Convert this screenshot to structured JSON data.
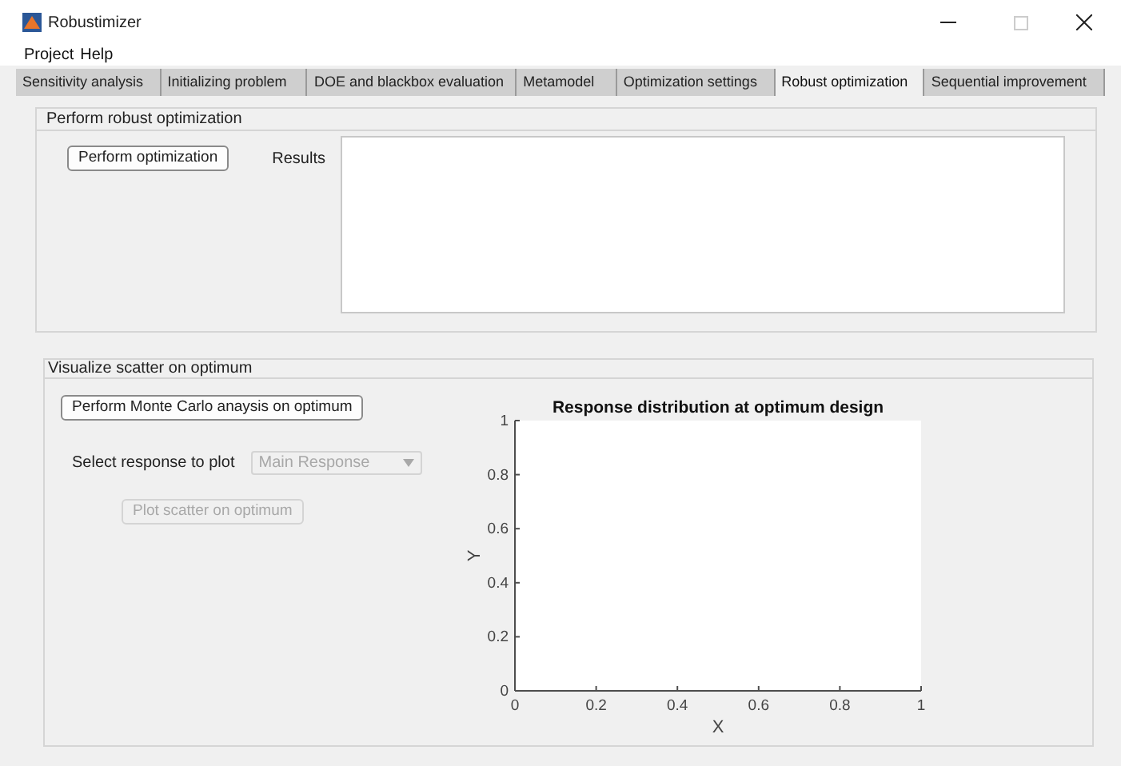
{
  "window": {
    "title": "Robustimizer"
  },
  "menu": [
    "Project",
    "Help"
  ],
  "tabs": [
    {
      "label": "Sensitivity analysis",
      "selected": false
    },
    {
      "label": "Initializing problem",
      "selected": false
    },
    {
      "label": "DOE and blackbox evaluation",
      "selected": false
    },
    {
      "label": "Metamodel",
      "selected": false
    },
    {
      "label": "Optimization settings",
      "selected": false
    },
    {
      "label": "Robust optimization",
      "selected": true
    },
    {
      "label": "Sequential improvement",
      "selected": false
    }
  ],
  "optimization_panel": {
    "title": "Perform robust optimization",
    "button": {
      "label": "Perform optimization",
      "disabled": false
    },
    "results_label": "Results"
  },
  "scatter_panel": {
    "title": "Visualize scatter on optimum",
    "monte_carlo_button": {
      "label": "Perform Monte Carlo anaysis on optimum",
      "disabled": false
    },
    "response_label": "Select response to plot",
    "response_select": {
      "value": "Main Response",
      "disabled": true
    },
    "plot_button": {
      "label": "Plot scatter on optimum",
      "disabled": true
    },
    "chart_data": {
      "type": "scatter",
      "title": "Response distribution at optimum design",
      "xlabel": "X",
      "ylabel": "Y",
      "xlim": [
        0,
        1
      ],
      "ylim": [
        0,
        1
      ],
      "xticks": [
        0,
        0.2,
        0.4,
        0.6,
        0.8,
        1
      ],
      "yticks": [
        0,
        0.2,
        0.4,
        0.6,
        0.8,
        1
      ]
    }
  }
}
